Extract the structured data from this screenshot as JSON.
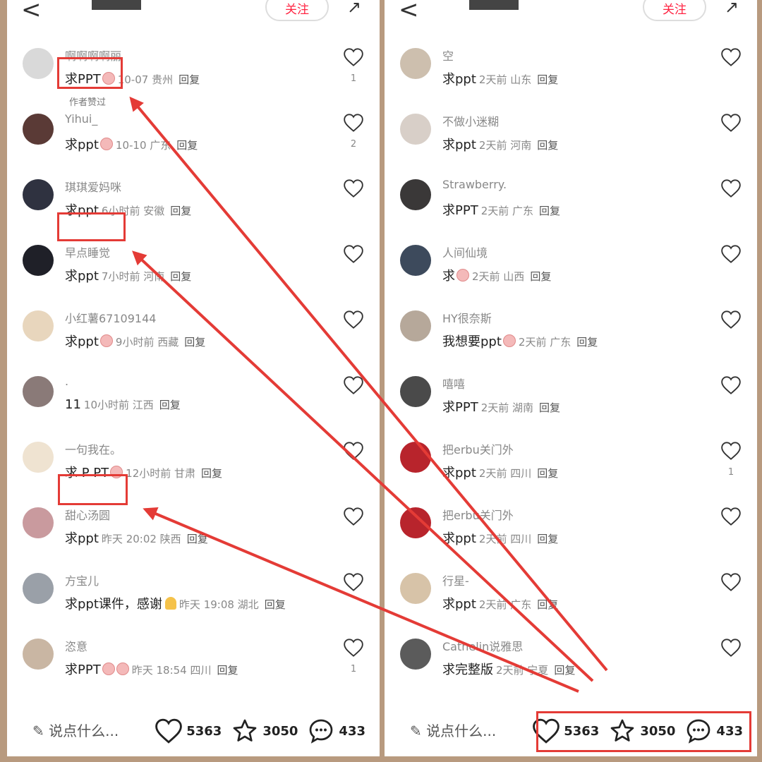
{
  "header": {
    "back_symbol": "<",
    "follow_label": "关注",
    "share_symbol": "↗"
  },
  "left_comments": [
    {
      "username": "啊啊啊啊丽",
      "text": "求PPT",
      "emoji": true,
      "meta": "10-07 贵州",
      "reply": "回复",
      "author_liked": "作者赞过",
      "likes": "1",
      "avatar_color": "#d9d9d9"
    },
    {
      "username": "Yihui_",
      "text": "求ppt",
      "emoji": true,
      "meta": "10-10 广东",
      "reply": "回复",
      "likes": "2",
      "avatar_color": "#5a3a36"
    },
    {
      "username": "琪琪爱妈咪",
      "text": "求ppt",
      "emoji": false,
      "meta": "6小时前 安徽",
      "reply": "回复",
      "likes": "",
      "avatar_color": "#2f3240"
    },
    {
      "username": "早点睡觉",
      "text": "求ppt",
      "emoji": false,
      "meta": "7小时前 河南",
      "reply": "回复",
      "likes": "",
      "avatar_color": "#1f2028"
    },
    {
      "username": "小红薯67109144",
      "text": "求ppt",
      "emoji": true,
      "meta": "9小时前 西藏",
      "reply": "回复",
      "likes": "",
      "avatar_color": "#e8d6bd"
    },
    {
      "username": ".",
      "text": "11",
      "emoji": false,
      "meta": "10小时前 江西",
      "reply": "回复",
      "likes": "",
      "avatar_color": "#8a7a78"
    },
    {
      "username": "一句我在。",
      "text": "求 P PT",
      "emoji": true,
      "meta": "12小时前 甘肃",
      "reply": "回复",
      "likes": "",
      "avatar_color": "#efe3d1"
    },
    {
      "username": "甜心汤圆",
      "text": "求ppt",
      "emoji": false,
      "meta": "昨天 20:02 陕西",
      "reply": "回复",
      "likes": "",
      "avatar_color": "#c99a9e"
    },
    {
      "username": "方宝儿",
      "text": "求ppt课件，感谢",
      "emoji": false,
      "pray": true,
      "meta": "昨天 19:08 湖北",
      "reply": "回复",
      "likes": "",
      "avatar_color": "#9aa0a8"
    },
    {
      "username": "恣意",
      "text": "求PPT",
      "emoji": true,
      "emoji2": true,
      "meta": "昨天 18:54 四川",
      "reply": "回复",
      "likes": "1",
      "avatar_color": "#c9b6a3"
    }
  ],
  "right_comments": [
    {
      "username": "空",
      "text": "求ppt",
      "emoji": false,
      "meta": "2天前 山东",
      "reply": "回复",
      "likes": "",
      "avatar_color": "#cdbfae"
    },
    {
      "username": "不做小迷糊",
      "text": "求ppt",
      "emoji": false,
      "meta": "2天前 河南",
      "reply": "回复",
      "likes": "",
      "avatar_color": "#d8cfc8"
    },
    {
      "username": "Strawberry.",
      "text": "求PPT",
      "emoji": false,
      "meta": "2天前 广东",
      "reply": "回复",
      "likes": "",
      "avatar_color": "#3a3838"
    },
    {
      "username": "人间仙境",
      "text": "求",
      "emoji": true,
      "meta": "2天前 山西",
      "reply": "回复",
      "likes": "",
      "avatar_color": "#3d4a5c"
    },
    {
      "username": "HY很奈斯",
      "text": "我想要ppt",
      "emoji": true,
      "meta": "2天前 广东",
      "reply": "回复",
      "likes": "",
      "avatar_color": "#b6a89a"
    },
    {
      "username": "嘻嘻",
      "text": "求PPT",
      "emoji": false,
      "meta": "2天前 湖南",
      "reply": "回复",
      "likes": "",
      "avatar_color": "#4a4a4a"
    },
    {
      "username": "把erbu关门外",
      "text": "求ppt",
      "emoji": false,
      "meta": "2天前 四川",
      "reply": "回复",
      "likes": "1",
      "avatar_color": "#b8242c"
    },
    {
      "username": "把erbu关门外",
      "text": "求ppt",
      "emoji": false,
      "meta": "2天前 四川",
      "reply": "回复",
      "likes": "",
      "avatar_color": "#b8242c"
    },
    {
      "username": "行星-",
      "text": "求ppt",
      "emoji": false,
      "meta": "2天前 广东",
      "reply": "回复",
      "likes": "",
      "avatar_color": "#d7c3a8"
    },
    {
      "username": "Cathelin说雅思",
      "text": "求完整版",
      "emoji": false,
      "meta": "2天前 宁夏",
      "reply": "回复",
      "likes": "",
      "avatar_color": "#5b5b5b"
    }
  ],
  "bottom": {
    "input_placeholder": "说点什么...",
    "likes": "5363",
    "stars": "3050",
    "comments": "433"
  },
  "colors": {
    "highlight": "#e43b36",
    "brand": "#ff2442"
  }
}
